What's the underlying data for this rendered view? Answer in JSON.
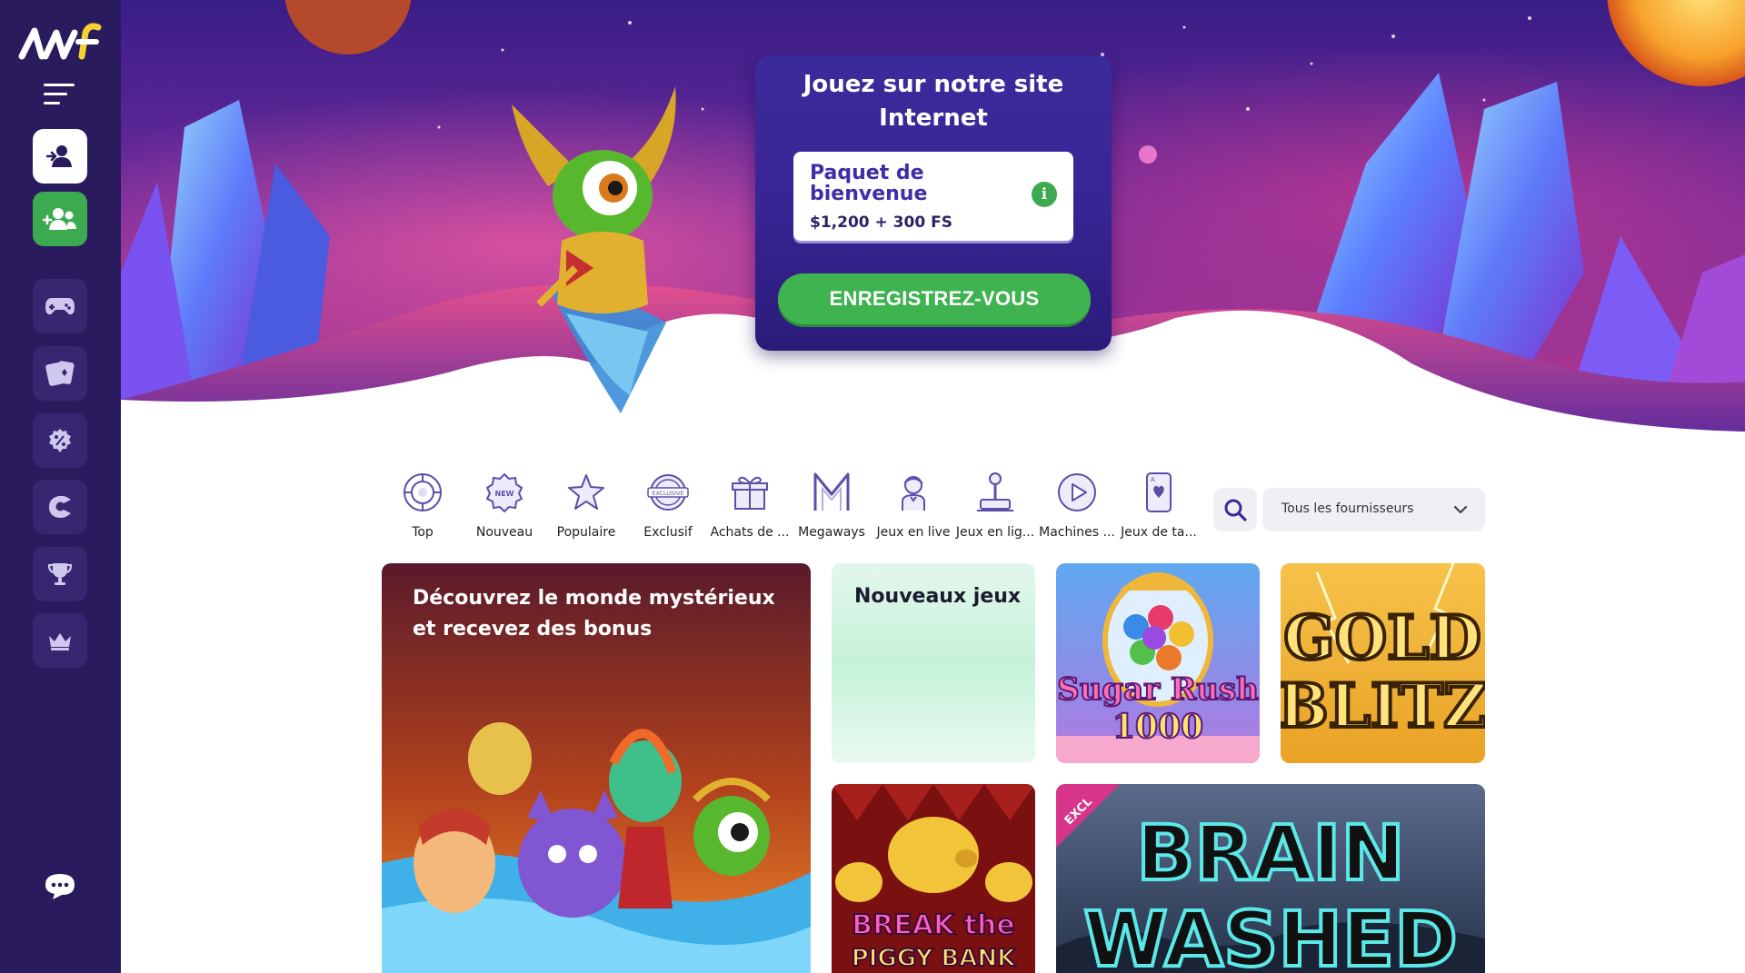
{
  "sidebar": {
    "logo_alt": "logo",
    "nav_items": [
      {
        "name": "games-icon"
      },
      {
        "name": "cards-icon"
      },
      {
        "name": "promotions-icon"
      },
      {
        "name": "loyalty-icon"
      },
      {
        "name": "tournaments-icon"
      },
      {
        "name": "vip-icon"
      }
    ]
  },
  "hero": {
    "title": "Jouez sur notre site Internet",
    "welcome_title": "Paquet de bienvenue",
    "welcome_amount": "$1,200 + 300 FS",
    "register_label": "ENREGISTREZ-VOUS"
  },
  "categories": [
    {
      "label": "Top",
      "icon": "top-icon"
    },
    {
      "label": "Nouveau",
      "icon": "new-icon"
    },
    {
      "label": "Populaire",
      "icon": "star-icon"
    },
    {
      "label": "Exclusif",
      "icon": "exclusive-icon"
    },
    {
      "label": "Achats de ...",
      "icon": "gift-icon"
    },
    {
      "label": "Megaways",
      "icon": "megaways-icon"
    },
    {
      "label": "Jeux en live",
      "icon": "live-dealer-icon"
    },
    {
      "label": "Jeux en lig...",
      "icon": "joystick-icon"
    },
    {
      "label": "Machines ...",
      "icon": "play-icon"
    },
    {
      "label": "Jeux de ta...",
      "icon": "card-icon"
    }
  ],
  "provider_select": {
    "value": "Tous les fournisseurs"
  },
  "games": {
    "banner_title": "Découvrez le monde mystérieux et recevez des bonus",
    "new_games_title": "Nouveaux jeux",
    "sugar_rush": {
      "line1": "Sugar Rush",
      "line2": "1000"
    },
    "gold_blitz": {
      "line1": "GOLD",
      "line2": "BLITZ"
    },
    "piggy": {
      "line1": "BREAK the",
      "line2": "PIGGY BANK"
    },
    "brain": {
      "line1": "BRAIN",
      "line2": "WASHED",
      "badge": "EXCL"
    }
  },
  "colors": {
    "sidebar": "#2a1a5e",
    "accent_green": "#3eb34f",
    "promo_purple": "#3a2b9b"
  }
}
